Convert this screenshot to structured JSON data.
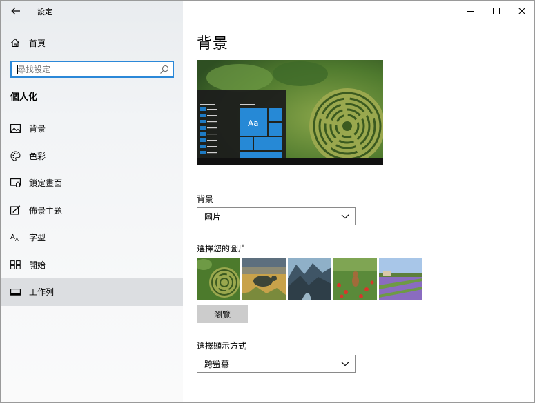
{
  "window": {
    "title": "設定"
  },
  "sidebar": {
    "home_label": "首頁",
    "search": {
      "placeholder": "尋找設定"
    },
    "section_title": "個人化",
    "items": [
      {
        "label": "背景",
        "icon": "picture-icon"
      },
      {
        "label": "色彩",
        "icon": "palette-icon"
      },
      {
        "label": "鎖定畫面",
        "icon": "lock-screen-icon"
      },
      {
        "label": "佈景主題",
        "icon": "theme-brush-icon"
      },
      {
        "label": "字型",
        "icon": "font-icon"
      },
      {
        "label": "開始",
        "icon": "start-grid-icon"
      },
      {
        "label": "工作列",
        "icon": "taskbar-icon"
      }
    ],
    "active_index": 6
  },
  "main": {
    "page_title": "背景",
    "preview_tile_text": "Aa",
    "background_label": "背景",
    "background_value": "圖片",
    "choose_picture_label": "選擇您的圖片",
    "browse_label": "瀏覽",
    "fit_label": "選擇顯示方式",
    "fit_value": "跨螢幕"
  },
  "colors": {
    "accent": "#1e7bc4",
    "tile_blue": "#2689d6",
    "search_border": "#2b88d8",
    "active_item_bg": "#dcdee1",
    "button_gray": "#cccccc"
  }
}
